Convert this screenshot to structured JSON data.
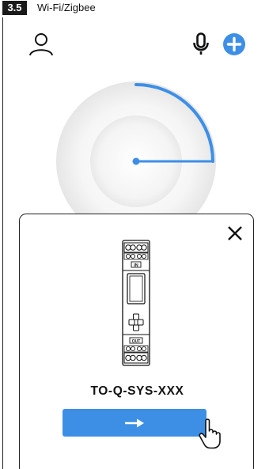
{
  "section": {
    "number": "3.5",
    "title": "Wi-Fi/Zigbee"
  },
  "header": {
    "icons": [
      "user-icon",
      "microphone-icon",
      "add-circle-icon"
    ]
  },
  "dial": {
    "progress_fraction": 0.25,
    "accent_color": "#3d8fe6"
  },
  "dialog": {
    "device_labels": {
      "in": "IN",
      "out": "OUT"
    },
    "model": "TO-Q-SYS-XXX",
    "button_icon": "arrow-right-icon",
    "button_color": "#3d8fe6",
    "close_icon": "close-icon"
  },
  "colors": {
    "accent": "#3d8fe6",
    "text": "#111111",
    "tag_background": "#1a1a1a"
  }
}
